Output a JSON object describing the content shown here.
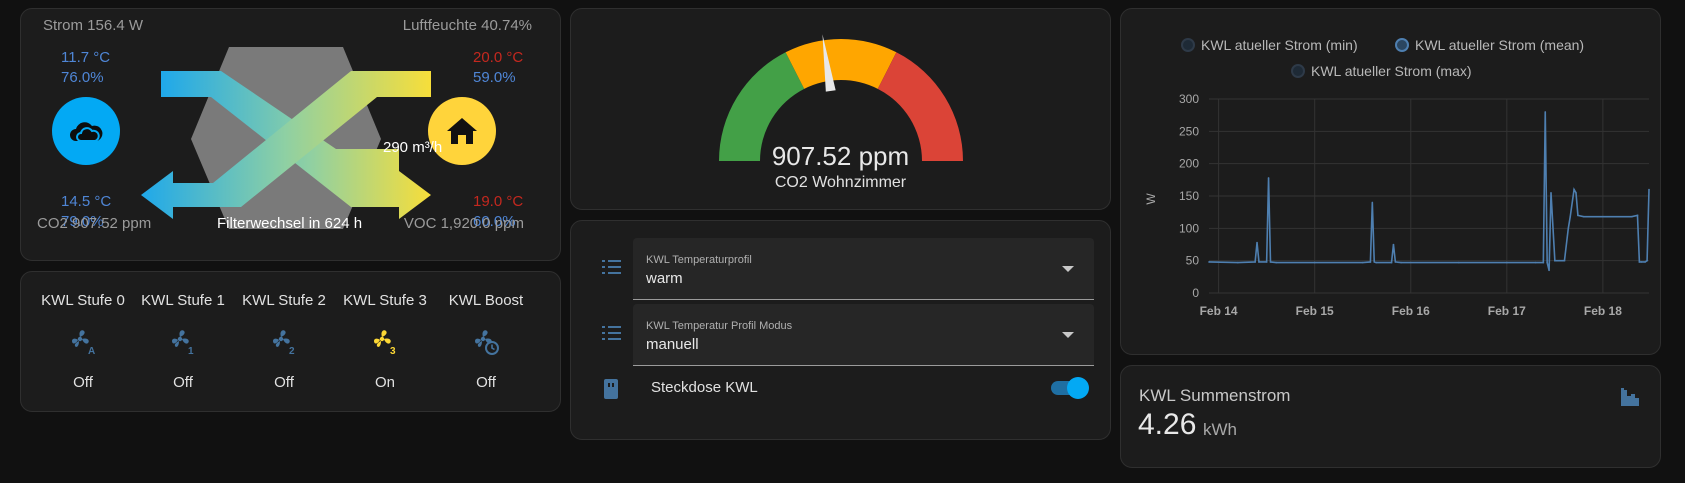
{
  "ventilation": {
    "power": "Strom 156.4 W",
    "humidity": "Luftfeuchte 40.74%",
    "outdoor_in_temp": "11.7 °C",
    "outdoor_in_hum": "76.0%",
    "indoor_out_temp": "20.0 °C",
    "indoor_out_hum": "59.0%",
    "exhaust_temp": "14.5 °C",
    "exhaust_hum": "79.0%",
    "supply_temp": "19.0 °C",
    "supply_hum": "60.0%",
    "flow": "290 m³/h",
    "co2": "CO2 907.52 ppm",
    "filter": "Filterwechsel in 624 h",
    "voc": "VOC 1,920.0 ppm"
  },
  "fans": [
    {
      "name": "KWL Stufe 0",
      "state": "Off",
      "badge": "A",
      "active": false,
      "icon": "fan-auto-icon"
    },
    {
      "name": "KWL Stufe 1",
      "state": "Off",
      "badge": "1",
      "active": false,
      "icon": "fan-speed-1-icon"
    },
    {
      "name": "KWL Stufe 2",
      "state": "Off",
      "badge": "2",
      "active": false,
      "icon": "fan-speed-2-icon"
    },
    {
      "name": "KWL Stufe 3",
      "state": "On",
      "badge": "3",
      "active": true,
      "icon": "fan-speed-3-icon"
    },
    {
      "name": "KWL Boost",
      "state": "Off",
      "badge": "clock",
      "active": false,
      "icon": "fan-clock-icon"
    }
  ],
  "gauge": {
    "value": 907.52,
    "min": 0,
    "max": 2000,
    "value_text": "907.52 ppm",
    "name": "CO2 Wohnzimmer",
    "segments": [
      {
        "from": 0,
        "to": 700,
        "color": "#43a047"
      },
      {
        "from": 700,
        "to": 1300,
        "color": "#ffa600"
      },
      {
        "from": 1300,
        "to": 2000,
        "color": "#db4437"
      }
    ]
  },
  "entities": {
    "select1": {
      "label": "KWL Temperaturprofil",
      "value": "warm"
    },
    "select2": {
      "label": "KWL Temperatur Profil Modus",
      "value": "manuell"
    },
    "switch": {
      "label": "Steckdose KWL",
      "on": true
    }
  },
  "colors": {
    "accent": "#03a9f4",
    "warm": "#ffd43b",
    "on": "#fdd835",
    "off": "#44739e"
  },
  "chart_data": {
    "type": "line",
    "title": "",
    "xlabel": "",
    "ylabel": "W",
    "ylim": [
      0,
      300
    ],
    "yticks": [
      "0",
      "50",
      "100",
      "150",
      "200",
      "250",
      "300"
    ],
    "xticks": [
      "Feb 14",
      "Feb 15",
      "Feb 16",
      "Feb 17",
      "Feb 18"
    ],
    "grid": true,
    "legend_position": "top",
    "legend": [
      "KWL atueller Strom (min)",
      "KWL atueller Strom (mean)",
      "KWL atueller Strom (max)"
    ],
    "series": [
      {
        "name": "KWL atueller Strom (mean)",
        "color": "#4e7fb0",
        "x": [
          13.9,
          14.2,
          14.38,
          14.4,
          14.42,
          14.5,
          14.52,
          14.54,
          14.6,
          15.0,
          15.5,
          15.58,
          15.6,
          15.62,
          15.64,
          15.8,
          15.82,
          15.84,
          15.9,
          16.5,
          17.0,
          17.3,
          17.38,
          17.4,
          17.42,
          17.44,
          17.46,
          17.5,
          17.55,
          17.6,
          17.64,
          17.66,
          17.7,
          17.72,
          17.74,
          17.8,
          18.0,
          18.3,
          18.36,
          18.38,
          18.4,
          18.44,
          18.46,
          18.48
        ],
        "y": [
          48,
          47,
          48,
          78,
          48,
          48,
          178,
          48,
          47,
          47,
          47,
          48,
          140,
          48,
          47,
          47,
          75,
          48,
          47,
          47,
          47,
          47,
          47,
          280,
          47,
          35,
          155,
          50,
          50,
          50,
          100,
          118,
          160,
          155,
          120,
          118,
          118,
          118,
          120,
          48,
          48,
          48,
          50,
          160
        ]
      }
    ]
  },
  "energy": {
    "name": "KWL Summenstrom",
    "value": "4.26",
    "unit": "kWh"
  }
}
